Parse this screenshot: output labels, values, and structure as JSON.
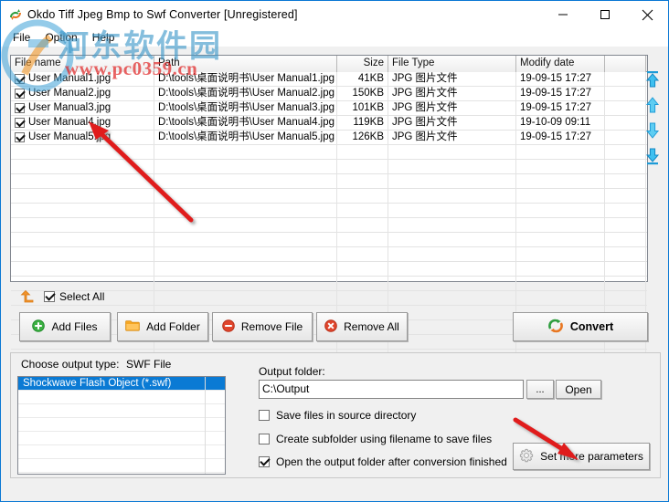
{
  "window": {
    "title": "Okdo Tiff Jpeg Bmp to Swf Converter [Unregistered]",
    "app_icon": "converter-icon",
    "minimize_label": "—",
    "maximize_label": "□",
    "close_label": "✕",
    "accent_color": "#0a78d4"
  },
  "menubar": {
    "items": [
      {
        "label": "File"
      },
      {
        "label": "Option"
      },
      {
        "label": "Help"
      }
    ]
  },
  "filelist": {
    "columns": [
      {
        "key": "name",
        "label": "File name"
      },
      {
        "key": "path",
        "label": "Path"
      },
      {
        "key": "size",
        "label": "Size"
      },
      {
        "key": "type",
        "label": "File Type"
      },
      {
        "key": "date",
        "label": "Modify date"
      },
      {
        "key": "blank",
        "label": ""
      }
    ],
    "rows": [
      {
        "checked": true,
        "name": "User Manual1.jpg",
        "path": "D:\\tools\\桌面说明书\\User Manual1.jpg",
        "size": "41KB",
        "type": "JPG 图片文件",
        "date": "19-09-15 17:27"
      },
      {
        "checked": true,
        "name": "User Manual2.jpg",
        "path": "D:\\tools\\桌面说明书\\User Manual2.jpg",
        "size": "150KB",
        "type": "JPG 图片文件",
        "date": "19-09-15 17:27"
      },
      {
        "checked": true,
        "name": "User Manual3.jpg",
        "path": "D:\\tools\\桌面说明书\\User Manual3.jpg",
        "size": "101KB",
        "type": "JPG 图片文件",
        "date": "19-09-15 17:27"
      },
      {
        "checked": true,
        "name": "User Manual4.jpg",
        "path": "D:\\tools\\桌面说明书\\User Manual4.jpg",
        "size": "119KB",
        "type": "JPG 图片文件",
        "date": "19-10-09 09:11"
      },
      {
        "checked": true,
        "name": "User Manual5.jpg",
        "path": "D:\\tools\\桌面说明书\\User Manual5.jpg",
        "size": "126KB",
        "type": "JPG 图片文件",
        "date": "19-09-15 17:27"
      }
    ]
  },
  "order_tools": [
    {
      "icon": "move-to-top-icon"
    },
    {
      "icon": "move-up-icon"
    },
    {
      "icon": "move-down-icon"
    },
    {
      "icon": "move-to-bottom-icon"
    }
  ],
  "toolbar": {
    "return_icon": "return-up-arrow-icon",
    "select_all_label": "Select All",
    "select_all_checked": true,
    "add_files_label": "Add Files",
    "add_folder_label": "Add Folder",
    "remove_file_label": "Remove File",
    "remove_all_label": "Remove All",
    "convert_label": "Convert"
  },
  "output": {
    "type_label": "Choose output type:",
    "type_value": "SWF File",
    "type_options": [
      "Shockwave Flash Object (*.swf)"
    ],
    "selected_type": "Shockwave Flash Object (*.swf)",
    "folder_label": "Output folder:",
    "folder_value": "C:\\Output",
    "browse_label": "...",
    "open_label": "Open",
    "options": [
      {
        "label": "Save files in source directory",
        "checked": false
      },
      {
        "label": "Create subfolder using filename to save files",
        "checked": false
      },
      {
        "label": "Open the output folder after conversion finished",
        "checked": true
      }
    ],
    "set_params_label": "Set more parameters",
    "set_params_icon": "gear-icon"
  },
  "watermark": {
    "site_cn": "河东软件园",
    "site_url": "www.pc0359.cn"
  }
}
